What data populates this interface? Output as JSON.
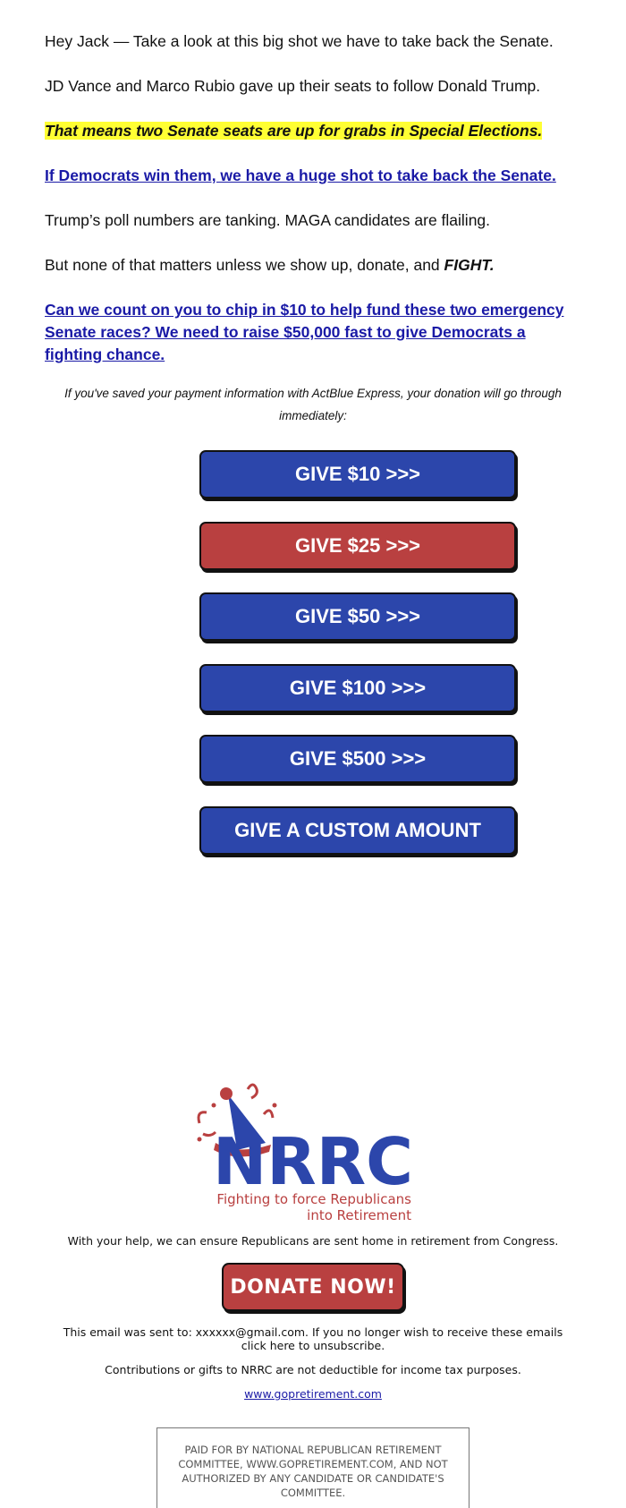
{
  "body": {
    "p1": "Hey Jack — Take a look at this big shot we have to take back the Senate.",
    "p2": "JD Vance and Marco Rubio gave up their seats to follow Donald Trump.",
    "p3_highlight": "That means two Senate seats are up for grabs in Special Elections.",
    "p4_link": "If Democrats win them, we have a huge shot to take back the Senate.",
    "p5": "Trump’s poll numbers are tanking. MAGA candidates are flailing.",
    "p6_text": "But none of that matters unless we show up, donate, and",
    "p6_emphasis": "FIGHT.",
    "p7_link": "Can we count on you to chip in $10 to help fund these two emergency Senate races? We need to raise $50,000 fast to give Democrats a fighting chance.",
    "express_note": "If you've saved your payment information with ActBlue Express, your donation will go through immediately:"
  },
  "buttons": {
    "give_10": "GIVE $10 >>>",
    "give_25": "GIVE $25 >>>",
    "give_50": "GIVE $50 >>>",
    "give_100": "GIVE $100 >>>",
    "give_500": "GIVE $500 >>>",
    "give_custom": "GIVE A CUSTOM AMOUNT"
  },
  "colors": {
    "blue_button": "#2c46ab",
    "red_button": "#b94040",
    "highlight": "#ffff33",
    "link": "#1a1aa6"
  },
  "footer": {
    "logo_text": "NRRC",
    "logo_tagline_1": "Fighting to force Republicans",
    "logo_tagline_2": "into Retirement",
    "mission": "With your help, we can ensure Republicans are sent home in retirement from Congress.",
    "donate_button": "DONATE NOW!",
    "sent_to": "This email was sent to: xxxxxx@gmail.com. If you no longer wish to receive these emails click here to unsubscribe.",
    "tax_note": "Contributions or gifts to NRRC are not deductible for income tax purposes.",
    "website": "www.gopretirement.com",
    "paid_for": "PAID FOR BY NATIONAL REPUBLICAN RETIREMENT COMMITTEE, WWW.GOPRETIREMENT.COM, AND NOT AUTHORIZED BY ANY CANDIDATE OR CANDIDATE'S COMMITTEE."
  }
}
